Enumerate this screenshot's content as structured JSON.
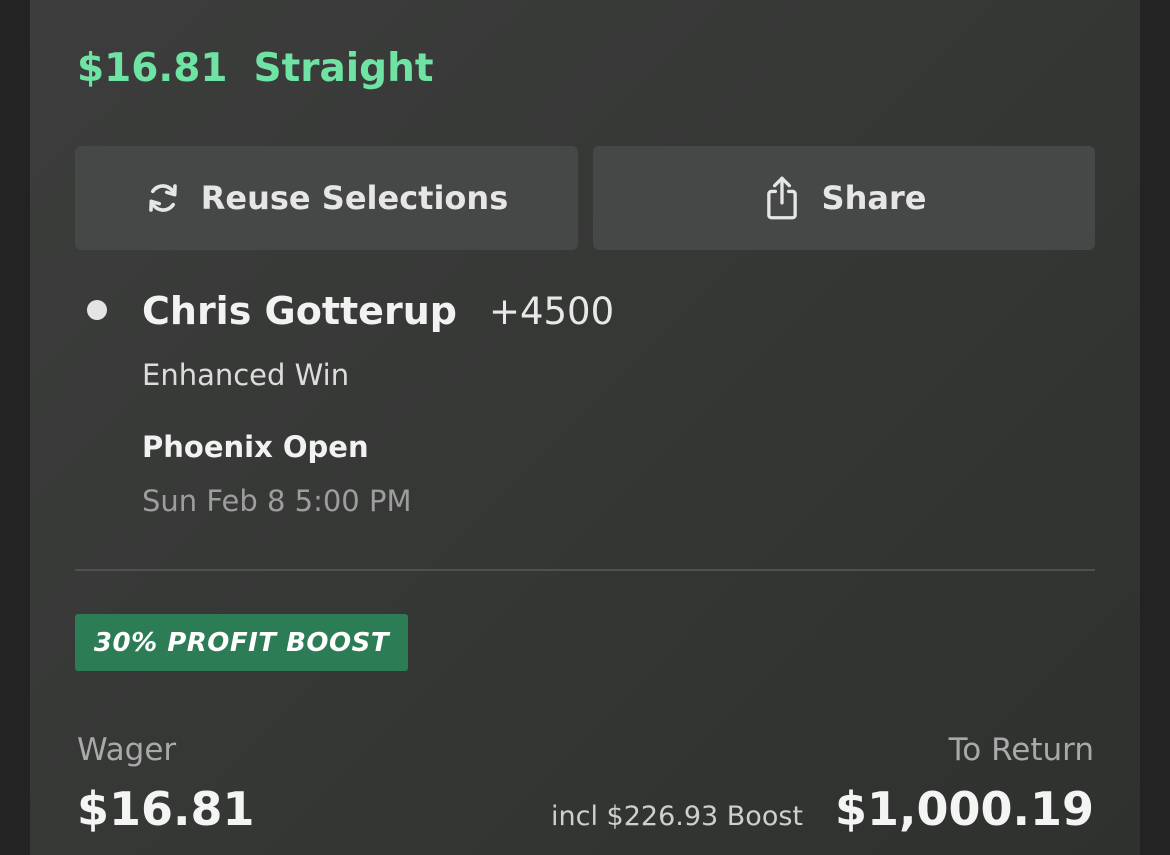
{
  "bet": {
    "amount": "$16.81",
    "type": "Straight"
  },
  "actions": {
    "reuse_label": "Reuse Selections",
    "reuse_icon": "refresh-icon",
    "share_label": "Share",
    "share_icon": "share-icon"
  },
  "selection": {
    "name": "Chris Gotterup",
    "odds": "+4500",
    "market": "Enhanced Win",
    "event": "Phoenix Open",
    "time": "Sun Feb 8 5:00 PM"
  },
  "boost": {
    "badge": "30% PROFIT BOOST",
    "note": "incl $226.93 Boost"
  },
  "summary": {
    "wager_label": "Wager",
    "wager_value": "$16.81",
    "return_label": "To Return",
    "return_value": "$1,000.19"
  },
  "colors": {
    "accent": "#6fe3a4",
    "boost_badge": "#2c7d56",
    "card_background": "#363836",
    "button_background": "#454846"
  }
}
